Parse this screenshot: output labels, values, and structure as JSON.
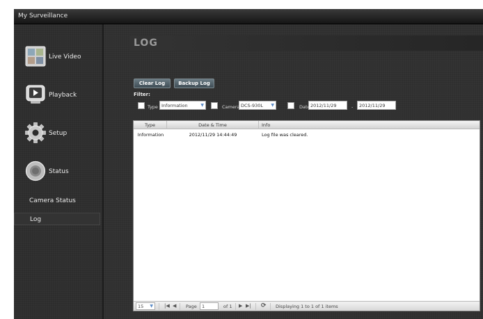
{
  "app": {
    "title": "My Surveillance"
  },
  "sidebar": {
    "items": [
      {
        "label": "Live Video",
        "icon": "live-video-icon"
      },
      {
        "label": "Playback",
        "icon": "playback-icon"
      },
      {
        "label": "Setup",
        "icon": "gear-icon"
      },
      {
        "label": "Status",
        "icon": "status-icon"
      }
    ],
    "subitems": [
      {
        "label": "Camera Status",
        "selected": false
      },
      {
        "label": "Log",
        "selected": true
      }
    ]
  },
  "main": {
    "title": "LOG",
    "buttons": {
      "clear": "Clear Log",
      "backup": "Backup Log"
    },
    "filter": {
      "label": "Filter:",
      "type_label": "Type",
      "type_value": "Information",
      "camera_label": "Camera",
      "camera_value": "DCS-930L",
      "date_label": "Date",
      "date_from": "2012/11/29",
      "date_sep": "-",
      "date_to": "2012/11/29"
    },
    "table": {
      "columns": [
        "Type",
        "Date & Time",
        "Info"
      ],
      "rows": [
        {
          "type": "Information",
          "datetime": "2012/11/29 14:44:49",
          "info": "Log file was cleared."
        }
      ]
    },
    "pager": {
      "page_size": "15",
      "page_label": "Page",
      "page_value": "1",
      "of_label": "of 1",
      "status": "Displaying 1 to 1 of 1 items"
    }
  },
  "colors": {
    "background": "#2f2f2f",
    "titlebar": "#1f1f1f",
    "button": "#4f5f68"
  }
}
